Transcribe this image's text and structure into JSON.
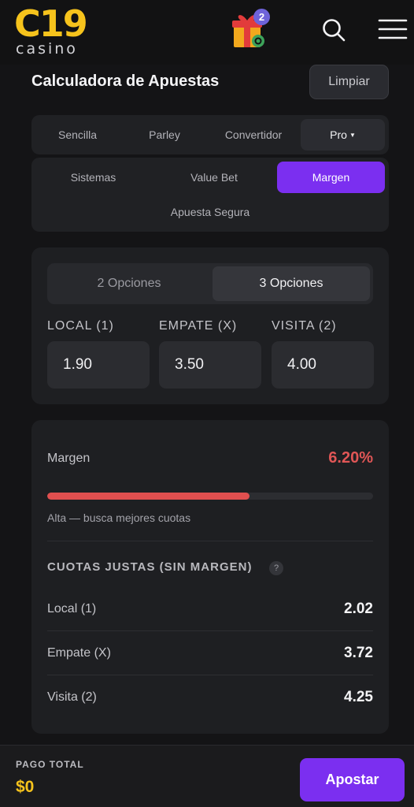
{
  "header": {
    "logo_main": "C19",
    "logo_sub": "casino",
    "gift_badge_count": "2",
    "icons": [
      "gift-icon",
      "search-icon",
      "hamburger-menu-icon"
    ],
    "brand_color": "#f6c31c"
  },
  "page": {
    "title": "Calculadora de Apuestas",
    "clear_label": "Limpiar"
  },
  "mode_tabs": {
    "single": "Sencilla",
    "parlay": "Parley",
    "converter": "Convertidor",
    "pro": "Pro",
    "active": "Pro"
  },
  "sub_tabs": {
    "systems": "Sistemas",
    "value_bet": "Value Bet",
    "margin": "Margen",
    "safe_bet": "Apuesta Segura",
    "active": "Margen",
    "accent_color": "#7b2ff0"
  },
  "options": {
    "two": "2 Opciones",
    "three": "3 Opciones",
    "active": "3 Opciones",
    "fields": [
      {
        "label": "LOCAL (1)",
        "value": "1.90"
      },
      {
        "label": "EMPATE (X)",
        "value": "3.50"
      },
      {
        "label": "VISITA (2)",
        "value": "4.00"
      }
    ]
  },
  "result": {
    "margin_label": "Margen",
    "margin_value": "6.20%",
    "margin_bar_percent": 62,
    "margin_color": "#e05656",
    "margin_note": "Alta — busca mejores cuotas",
    "fair_heading": "CUOTAS JUSTAS (SIN MARGEN)",
    "help_glyph": "?",
    "fair_odds": [
      {
        "name": "Local (1)",
        "value": "2.02"
      },
      {
        "name": "Empate (X)",
        "value": "3.72"
      },
      {
        "name": "Visita (2)",
        "value": "4.25"
      }
    ]
  },
  "footer": {
    "total_label": "PAGO TOTAL",
    "total_value": "$0",
    "bet_label": "Apostar"
  }
}
